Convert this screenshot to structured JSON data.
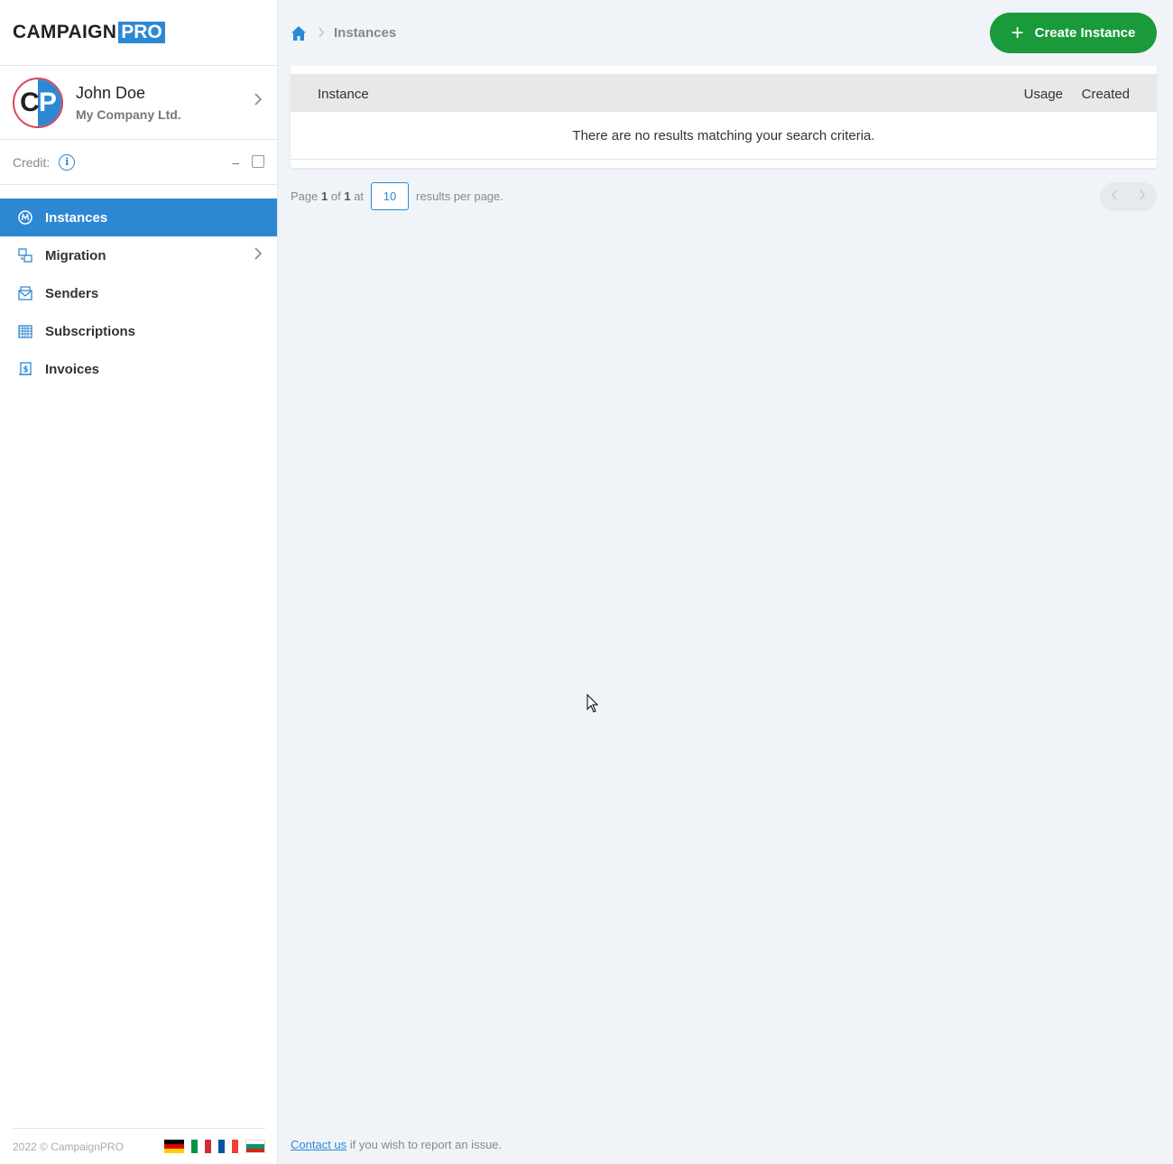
{
  "brand": {
    "name_part1": "CAMPAIGN",
    "name_part2": "PRO"
  },
  "user": {
    "avatar_initials_1": "C",
    "avatar_initials_2": "P",
    "name": "John Doe",
    "company": "My Company Ltd."
  },
  "credit": {
    "label": "Credit:",
    "value": "–"
  },
  "nav": {
    "items": [
      {
        "label": "Instances",
        "icon": "instances-icon",
        "active": true
      },
      {
        "label": "Migration",
        "icon": "migration-icon",
        "has_submenu": true
      },
      {
        "label": "Senders",
        "icon": "envelope-icon"
      },
      {
        "label": "Subscriptions",
        "icon": "calendar-icon"
      },
      {
        "label": "Invoices",
        "icon": "invoice-icon"
      }
    ]
  },
  "sidebar_footer": {
    "copyright": "2022 © CampaignPRO",
    "languages": [
      "de",
      "it",
      "fr",
      "bg"
    ]
  },
  "breadcrumb": {
    "current": "Instances"
  },
  "actions": {
    "create_label": "Create Instance"
  },
  "table": {
    "columns": [
      "Instance",
      "Usage",
      "Created"
    ],
    "empty_message": "There are no results matching your search criteria."
  },
  "pagination": {
    "page_label": "Page",
    "current_page": "1",
    "of_label": "of",
    "total_pages": "1",
    "at_label": "at",
    "per_page": "10",
    "suffix": "results per page."
  },
  "footer": {
    "contact_link": "Contact us",
    "contact_text": "if you wish to report an issue."
  },
  "colors": {
    "primary": "#2d88d4",
    "success": "#1a9a3a",
    "background": "#f0f4f9"
  }
}
